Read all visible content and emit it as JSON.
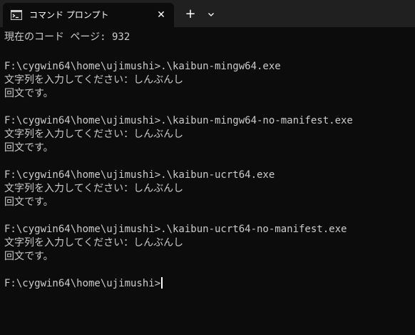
{
  "window": {
    "tab_title": "コマンド プロンプト",
    "tab_icon": "cmd-icon",
    "close_glyph": "✕",
    "new_tab_glyph": "+",
    "dropdown_icon": "chevron-down-icon"
  },
  "colors": {
    "titlebar": "#202020",
    "console_bg": "#0c0c0c",
    "console_text": "#cccccc"
  },
  "console": {
    "lines": [
      "現在のコード ページ: 932",
      "",
      "F:\\cygwin64\\home\\ujimushi>.\\kaibun-mingw64.exe",
      "文字列を入力してください：しんぶんし",
      "回文です。",
      "",
      "F:\\cygwin64\\home\\ujimushi>.\\kaibun-mingw64-no-manifest.exe",
      "文字列を入力してください：しんぶんし",
      "回文です。",
      "",
      "F:\\cygwin64\\home\\ujimushi>.\\kaibun-ucrt64.exe",
      "文字列を入力してください：しんぶんし",
      "回文です。",
      "",
      "F:\\cygwin64\\home\\ujimushi>.\\kaibun-ucrt64-no-manifest.exe",
      "文字列を入力してください：しんぶんし",
      "回文です。",
      "",
      "F:\\cygwin64\\home\\ujimushi>"
    ]
  }
}
